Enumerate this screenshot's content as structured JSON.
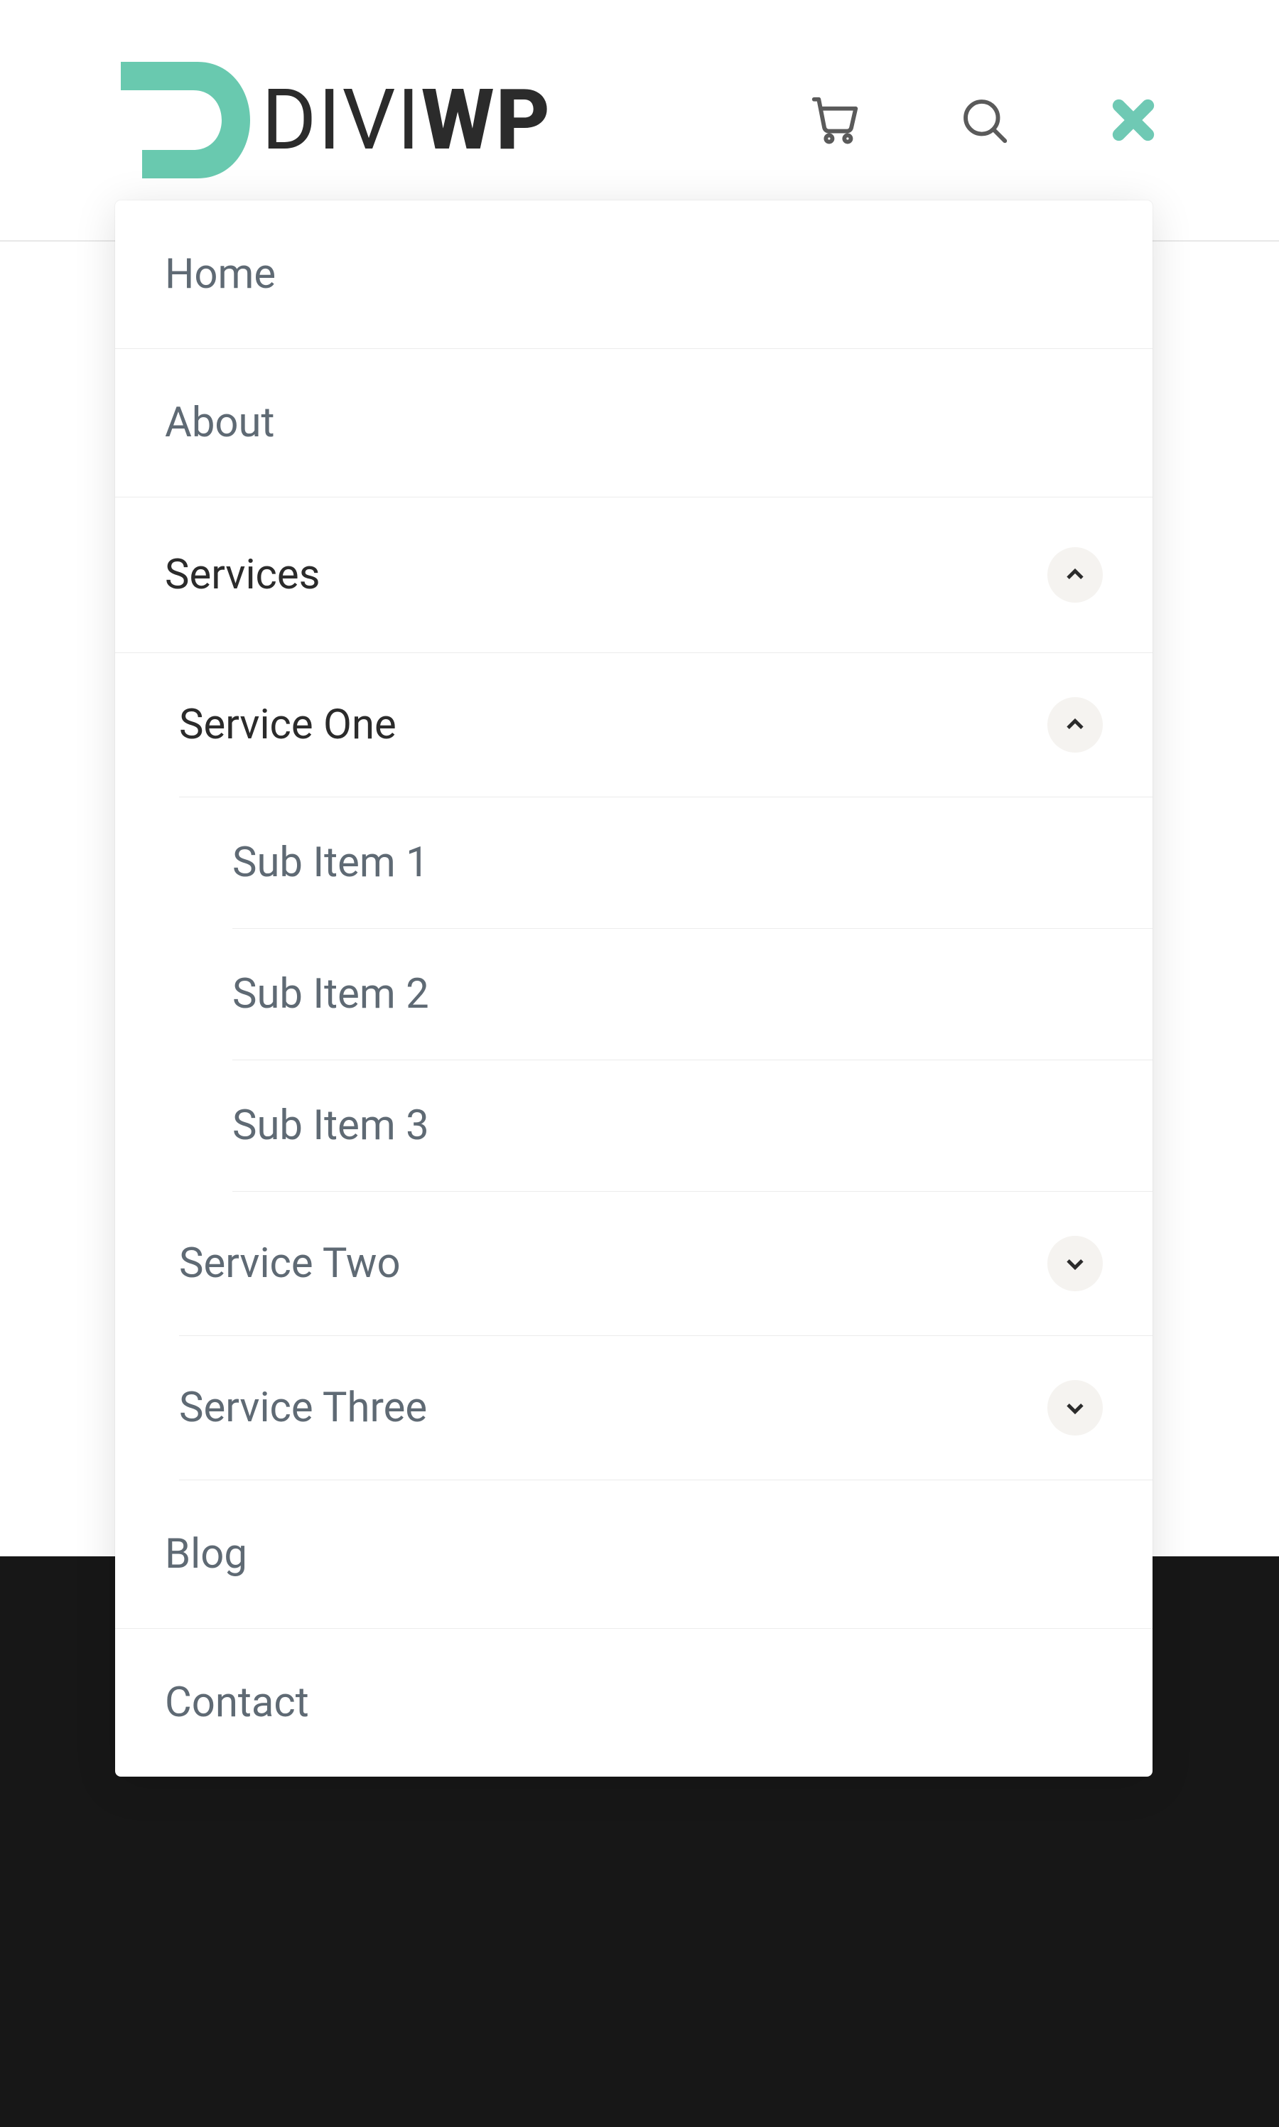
{
  "brand": {
    "name_left": "DIVI",
    "name_right": "WP",
    "accent": "#69c9af",
    "dark": "#2b2b2b"
  },
  "header": {
    "icons": {
      "cart": "cart-icon",
      "search": "search-icon",
      "close": "close-icon"
    }
  },
  "menu": {
    "items": [
      {
        "label": "Home",
        "active": false,
        "expanded": false,
        "has_children": false
      },
      {
        "label": "About",
        "active": false,
        "expanded": false,
        "has_children": false
      },
      {
        "label": "Services",
        "active": true,
        "expanded": true,
        "has_children": true,
        "children": [
          {
            "label": "Service One",
            "active": true,
            "expanded": true,
            "has_children": true,
            "children": [
              {
                "label": "Sub Item 1"
              },
              {
                "label": "Sub Item 2"
              },
              {
                "label": "Sub Item 3"
              }
            ]
          },
          {
            "label": "Service Two",
            "active": false,
            "expanded": false,
            "has_children": true
          },
          {
            "label": "Service Three",
            "active": false,
            "expanded": false,
            "has_children": true
          }
        ]
      },
      {
        "label": "Blog",
        "active": false,
        "expanded": false,
        "has_children": false
      },
      {
        "label": "Contact",
        "active": false,
        "expanded": false,
        "has_children": false
      }
    ]
  }
}
